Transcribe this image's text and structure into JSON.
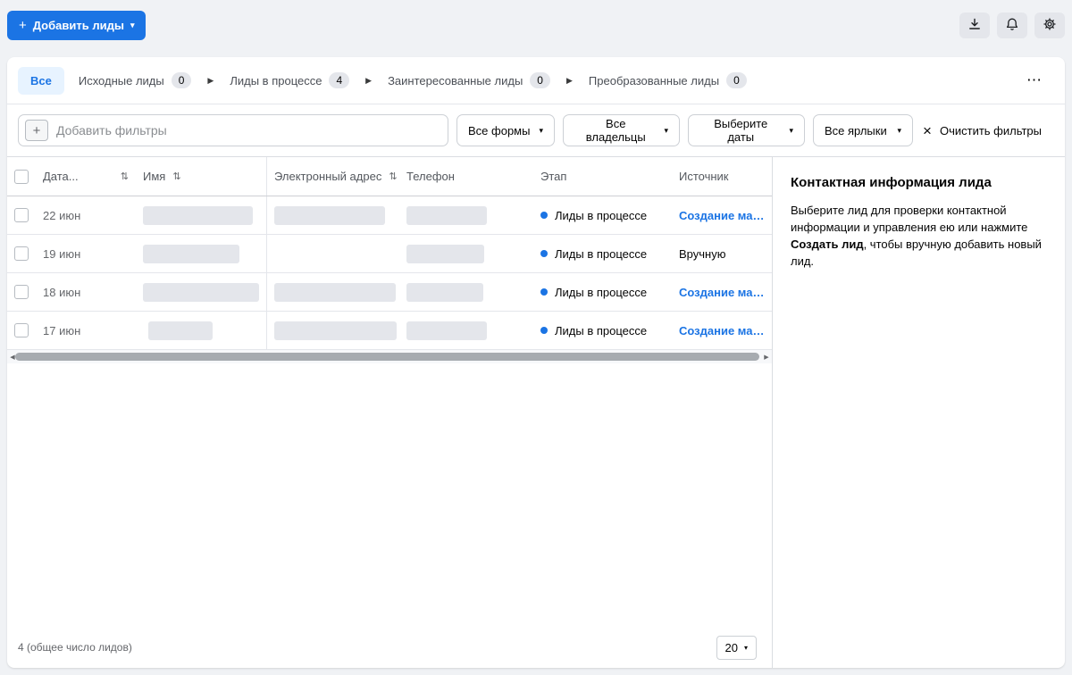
{
  "topbar": {
    "add_leads_label": "Добавить лиды"
  },
  "tabs": {
    "all_label": "Все",
    "stages": [
      {
        "label": "Исходные лиды",
        "count": "0"
      },
      {
        "label": "Лиды в процессе",
        "count": "4"
      },
      {
        "label": "Заинтересованные лиды",
        "count": "0"
      },
      {
        "label": "Преобразованные лиды",
        "count": "0"
      }
    ]
  },
  "filters": {
    "placeholder": "Добавить фильтры",
    "forms_label": "Все формы",
    "owners_label": "Все владельцы",
    "dates_label": "Выберите даты",
    "labels_label": "Все ярлыки",
    "clear_label": "Очистить фильтры"
  },
  "table": {
    "headers": {
      "date": "Дата...",
      "name": "Имя",
      "email": "Электронный адрес",
      "phone": "Телефон",
      "stage": "Этап",
      "source": "Источник"
    },
    "rows": [
      {
        "date": "22 июн",
        "stage": "Лиды в процессе",
        "source": "Создание масок_"
      },
      {
        "date": "19 июн",
        "stage": "Лиды в процессе",
        "source": "Вручную"
      },
      {
        "date": "18 июн",
        "stage": "Лиды в процессе",
        "source": "Создание масок_"
      },
      {
        "date": "17 июн",
        "stage": "Лиды в процессе",
        "source": "Создание масок_"
      }
    ],
    "footer": {
      "total_label": "4 (общее число лидов)",
      "page_size": "20"
    }
  },
  "detail": {
    "title": "Контактная информация лида",
    "body_1": "Выберите лид для проверки контактной информации и управления ею или нажмите ",
    "body_bold": "Создать лид",
    "body_2": ", чтобы вручную добавить новый лид."
  },
  "icons": {
    "plus": "+",
    "caret": "▾",
    "separator": "▶",
    "sort": "⇅",
    "clear_x": "×",
    "more": "⋯",
    "scroll_left": "◀",
    "scroll_right": "▶"
  },
  "colors": {
    "accent": "#1b74e4",
    "status_dot": "#1b74e4"
  }
}
